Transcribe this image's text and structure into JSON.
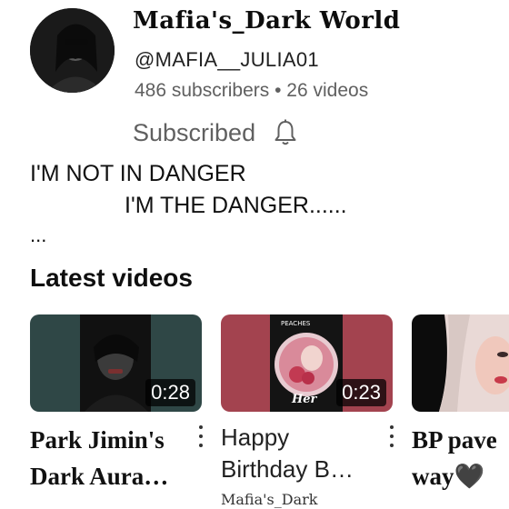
{
  "channel": {
    "name": "Mafia's_Dark World",
    "handle": "@MAFIA__JULIA01",
    "subscribers": "486 subscribers",
    "separator": "•",
    "videos": "26 videos",
    "subscribe_label": "Subscribed",
    "description": [
      "I'M NOT IN DANGER",
      "I'M THE DANGER......"
    ],
    "description_more": "..."
  },
  "latest": {
    "title": "Latest videos",
    "videos": [
      {
        "title_lines": [
          "Park Jimin's",
          "Dark Aura…"
        ],
        "duration": "0:28"
      },
      {
        "title_lines": [
          "Happy",
          "Birthday B…"
        ],
        "duration": "0:23",
        "channel_peek": "Mafia's_Dark",
        "thumb_badge": "PEACHES",
        "thumb_caption": "Her"
      },
      {
        "title_lines": [
          "BP pave",
          "way🖤"
        ]
      }
    ]
  },
  "colors": {
    "meta_gray": "#606060",
    "thumb1": "#2f4746",
    "thumb2": "#a3434f"
  },
  "icons": [
    "bell-icon",
    "more-vert-icon"
  ]
}
